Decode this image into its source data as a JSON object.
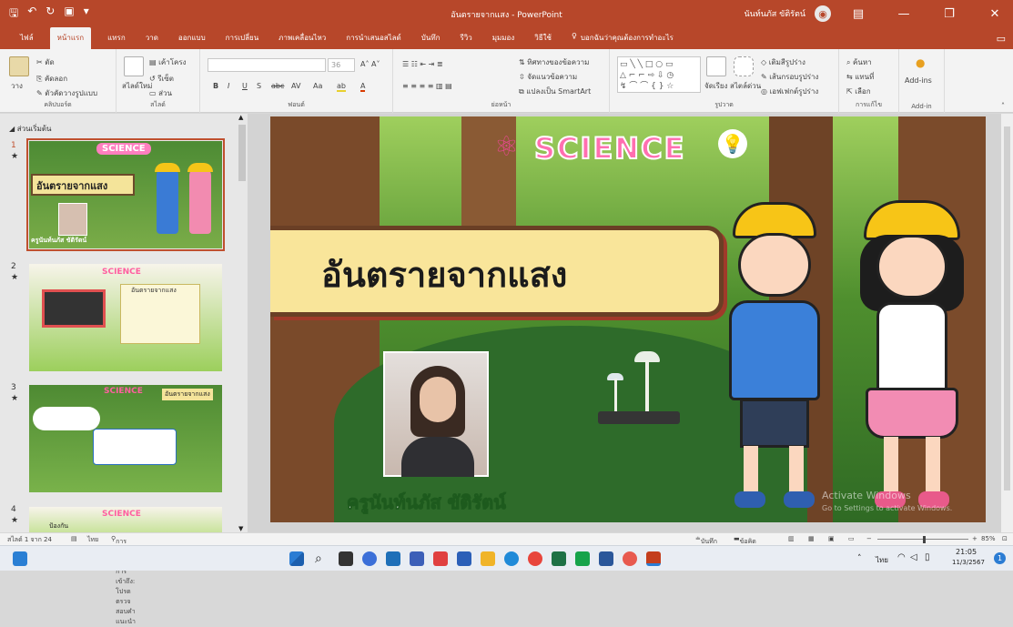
{
  "window": {
    "title": "อันตรายจากแสง  -  PowerPoint",
    "user": "นันท์นภัส ขัติรัตน์",
    "qat_icons": [
      "save-icon",
      "undo-icon",
      "redo-icon",
      "present-icon",
      "customize-icon"
    ]
  },
  "menu": {
    "tabs": [
      "ไฟล์",
      "หน้าแรก",
      "แทรก",
      "วาด",
      "ออกแบบ",
      "การเปลี่ยน",
      "ภาพเคลื่อนไหว",
      "การนำเสนอสไลด์",
      "บันทึก",
      "รีวิว",
      "มุมมอง",
      "วิธีใช้"
    ],
    "active_index": 1,
    "tell_me": "บอกฉันว่าคุณต้องการทำอะไร"
  },
  "ribbon": {
    "clipboard": {
      "label": "คลิปบอร์ด",
      "paste": "วาง",
      "cut": "ตัด",
      "copy": "คัดลอก",
      "format_painter": "ตัวคัดวางรูปแบบ"
    },
    "slides": {
      "label": "สไลด์",
      "new_slide": "สไลด์ใหม่",
      "layout": "เค้าโครง",
      "reset": "รีเซ็ต",
      "section": "ส่วน"
    },
    "font": {
      "label": "ฟอนต์",
      "font_name": "",
      "font_size": "36",
      "bold": "B",
      "italic": "I",
      "underline": "U",
      "shadow": "S",
      "strike": "abc",
      "spacing": "AV",
      "case": "Aa",
      "color": "A"
    },
    "paragraph": {
      "label": "ย่อหน้า",
      "text_direction": "ทิศทางของข้อความ",
      "align_text": "จัดแนวข้อความ",
      "smartart": "แปลงเป็น SmartArt"
    },
    "drawing": {
      "label": "รูปวาด",
      "arrange": "จัดเรียง",
      "quick_styles": "สไตล์ด่วน",
      "shape_fill": "เติมสีรูปร่าง",
      "shape_outline": "เส้นกรอบรูปร่าง",
      "shape_effects": "เอฟเฟกต์รูปร่าง"
    },
    "editing": {
      "label": "การแก้ไข",
      "find": "ค้นหา",
      "replace": "แทนที่",
      "select": "เลือก"
    },
    "addins": {
      "label": "Add-in",
      "button": "Add-ins"
    }
  },
  "outline": {
    "section": "ส่วนเริ่มต้น",
    "slides": [
      {
        "num": "1",
        "title": "อันตรายจากแสง",
        "teacher": "ครูนันท์นภัส ขัติรัตน์",
        "science": "SCIENCE"
      },
      {
        "num": "2",
        "title": "อันตรายจากแสง",
        "science": "SCIENCE"
      },
      {
        "num": "3",
        "title": "อันตรายจากแสง",
        "science": "SCIENCE"
      },
      {
        "num": "4",
        "title": "ป้องกัน",
        "science": "SCIENCE"
      }
    ]
  },
  "slide": {
    "science_title": "SCIENCE",
    "title": "อันตรายจากแสง",
    "teacher": "ครูนันท์นภัส ขัติรัตน์",
    "watermark_line1": "Activate Windows",
    "watermark_line2": "Go to Settings to activate Windows."
  },
  "status": {
    "slide_count": "สไลด์ 1 จาก 24",
    "language": "ไทย",
    "accessibility": "การช่วยสำหรับการเข้าถึง: โปรดตรวจสอบคำแนะนำ",
    "notes": "บันทึกย่อ",
    "comments": "ข้อคิดเห็น",
    "zoom": "85%"
  },
  "taskbar": {
    "time": "21:05",
    "date": "11/3/2567",
    "lang": "ไทย",
    "notif_count": "1"
  },
  "colors": {
    "accent": "#b7472a",
    "ribbon_bg": "#f3f3f3"
  }
}
